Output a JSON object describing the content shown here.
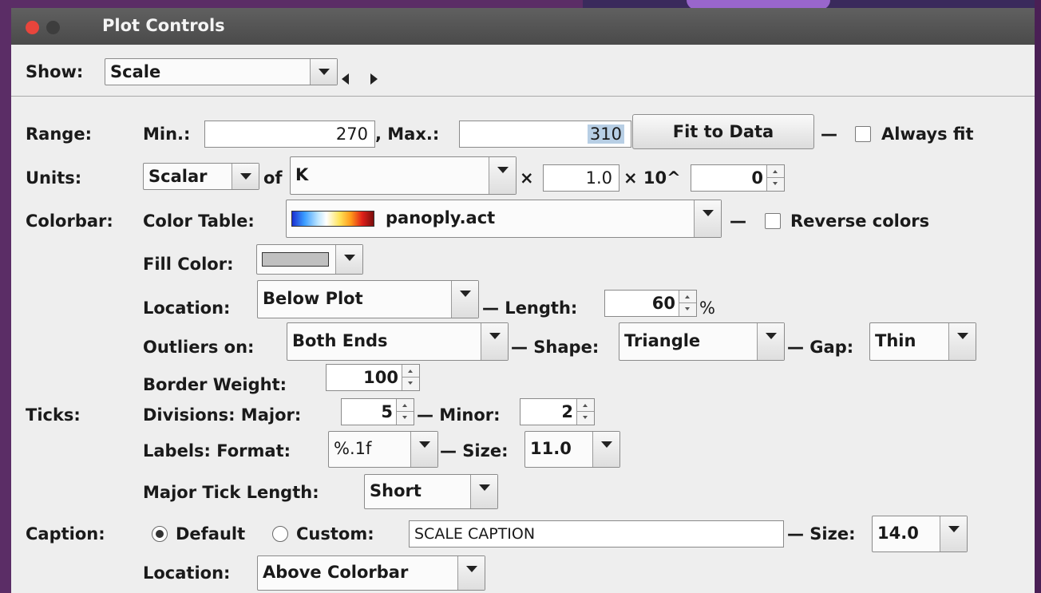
{
  "window": {
    "title": "Plot Controls"
  },
  "show": {
    "label": "Show:",
    "value": "Scale"
  },
  "range": {
    "label": "Range:",
    "min_label": "Min.:",
    "min_value": "270",
    "max_label": ", Max.:",
    "max_value": "310",
    "fit_button": "Fit to Data",
    "dash": "—",
    "always_fit_label": "Always fit"
  },
  "units": {
    "label": "Units:",
    "type": "Scalar",
    "of_label": "of",
    "unit": "K",
    "times1": "×",
    "factor": "1.0",
    "times2": "× 10^",
    "exponent": "0"
  },
  "colorbar": {
    "label": "Colorbar:",
    "table_label": "Color Table:",
    "table_value": "panoply.act",
    "dash": "—",
    "reverse_label": "Reverse colors",
    "fill_label": "Fill Color:",
    "location_label": "Location:",
    "location_value": "Below Plot",
    "length_label": "— Length:",
    "length_value": "60",
    "length_unit": "%",
    "outliers_label": "Outliers on:",
    "outliers_value": "Both Ends",
    "shape_label": "— Shape:",
    "shape_value": "Triangle",
    "gap_label": "— Gap:",
    "gap_value": "Thin",
    "border_label": "Border Weight:",
    "border_value": "100"
  },
  "ticks": {
    "label": "Ticks:",
    "divisions_label": "Divisions: Major:",
    "major_value": "5",
    "minor_label": "— Minor:",
    "minor_value": "2",
    "format_label": "Labels: Format:",
    "format_value": "%.1f",
    "size_label": "— Size:",
    "size_value": "11.0",
    "length_label": "Major Tick Length:",
    "length_value": "Short"
  },
  "caption": {
    "label": "Caption:",
    "default_label": "Default",
    "custom_label": "Custom:",
    "custom_value": "SCALE CAPTION",
    "size_label": "— Size:",
    "size_value": "14.0",
    "location_label": "Location:",
    "location_value": "Above Colorbar"
  }
}
